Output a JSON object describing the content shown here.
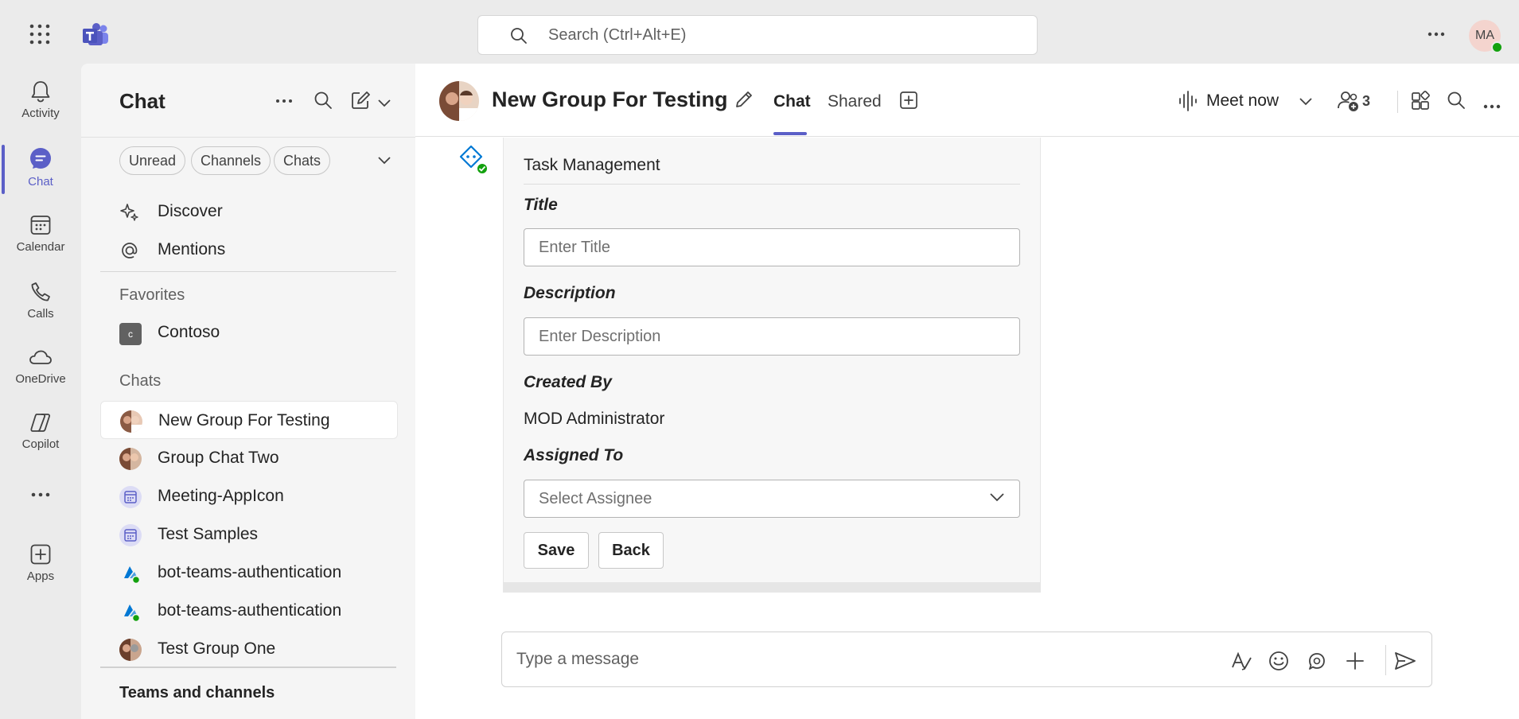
{
  "search": {
    "placeholder": "Search (Ctrl+Alt+E)"
  },
  "user": {
    "initials": "MA"
  },
  "rail": {
    "items": [
      {
        "label": "Activity",
        "icon": "bell-icon"
      },
      {
        "label": "Chat",
        "icon": "chat-icon"
      },
      {
        "label": "Calendar",
        "icon": "calendar-icon"
      },
      {
        "label": "Calls",
        "icon": "phone-icon"
      },
      {
        "label": "OneDrive",
        "icon": "cloud-icon"
      },
      {
        "label": "Copilot",
        "icon": "copilot-icon"
      },
      {
        "label": "Apps",
        "icon": "apps-icon"
      }
    ]
  },
  "sidebar": {
    "title": "Chat",
    "filters": [
      "Unread",
      "Channels",
      "Chats"
    ],
    "nav": [
      {
        "label": "Discover",
        "icon": "sparkle-icon"
      },
      {
        "label": "Mentions",
        "icon": "at-icon"
      }
    ],
    "favorites_label": "Favorites",
    "favorites": [
      {
        "label": "Contoso",
        "initial": "c"
      }
    ],
    "chats_label": "Chats",
    "chats": [
      {
        "label": "New Group For Testing"
      },
      {
        "label": "Group Chat Two"
      },
      {
        "label": "Meeting-AppIcon"
      },
      {
        "label": "Test Samples"
      },
      {
        "label": "bot-teams-authentication"
      },
      {
        "label": "bot-teams-authentication"
      },
      {
        "label": "Test Group One"
      }
    ],
    "teams_label": "Teams and channels"
  },
  "header": {
    "title": "New Group For Testing",
    "tabs": [
      "Chat",
      "Shared"
    ],
    "meet_now": "Meet now",
    "participants": "3"
  },
  "card": {
    "title": "Task Management",
    "title_label": "Title",
    "title_placeholder": "Enter Title",
    "description_label": "Description",
    "description_placeholder": "Enter Description",
    "created_by_label": "Created By",
    "created_by_value": "MOD Administrator",
    "assigned_to_label": "Assigned To",
    "assignee_placeholder": "Select Assignee",
    "save_label": "Save",
    "back_label": "Back"
  },
  "composer": {
    "placeholder": "Type a message"
  },
  "colors": {
    "accent": "#5b5fc7",
    "presence": "#13a10e",
    "background": "#ebebeb"
  }
}
